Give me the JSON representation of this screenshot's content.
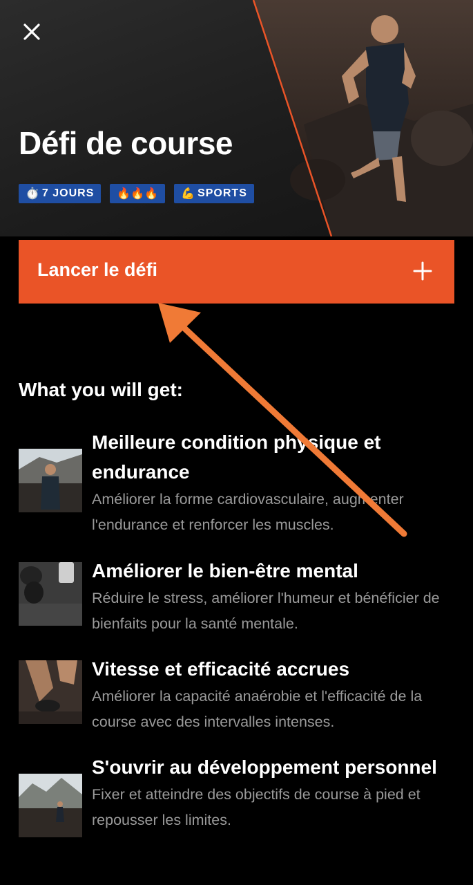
{
  "header": {
    "title": "Défi de course",
    "tags": [
      {
        "emoji": "⏱️",
        "label": "7 JOURS"
      },
      {
        "emoji": "🔥🔥🔥",
        "label": ""
      },
      {
        "emoji": "💪",
        "label": "SPORTS"
      }
    ]
  },
  "cta": {
    "label": "Lancer le défi"
  },
  "benefits_section": {
    "title": "What you will get:",
    "items": [
      {
        "title": "Meilleure condition physique et endurance",
        "description": "Améliorer la forme cardiovasculaire, augmenter l'endurance et renforcer les muscles."
      },
      {
        "title": "Améliorer le bien-être mental",
        "description": "Réduire le stress, améliorer l'humeur et bénéficier de bienfaits pour la santé mentale."
      },
      {
        "title": "Vitesse et efficacité accrues",
        "description": "Améliorer la capacité anaérobie et l'efficacité de la course avec des intervalles intenses."
      },
      {
        "title": "S'ouvrir au développement personnel",
        "description": "Fixer et atteindre des objectifs de course à pied et repousser les limites."
      }
    ]
  },
  "colors": {
    "accent": "#ea5427",
    "tag_background": "#1f4ea3",
    "annotation_arrow": "#f07a36"
  }
}
